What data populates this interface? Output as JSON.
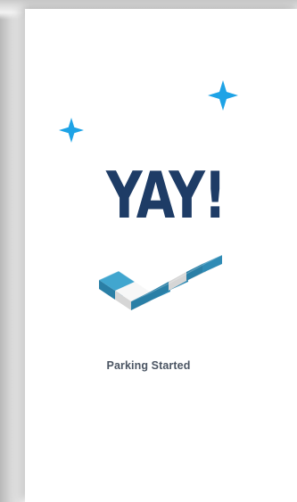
{
  "screen": {
    "headline": "YAY!",
    "status_message": "Parking Started"
  },
  "colors": {
    "headline": "#1e3c66",
    "status_text": "#4b5563",
    "sparkle": "#1ea3e6",
    "check_blue_top": "#41a6cf",
    "check_blue_side": "#2a7fa6",
    "check_white_top": "#f7f7f7",
    "check_white_side": "#d6d6d6"
  },
  "icons": {
    "sparkle": "four-point-star",
    "check": "checkmark-isometric"
  }
}
